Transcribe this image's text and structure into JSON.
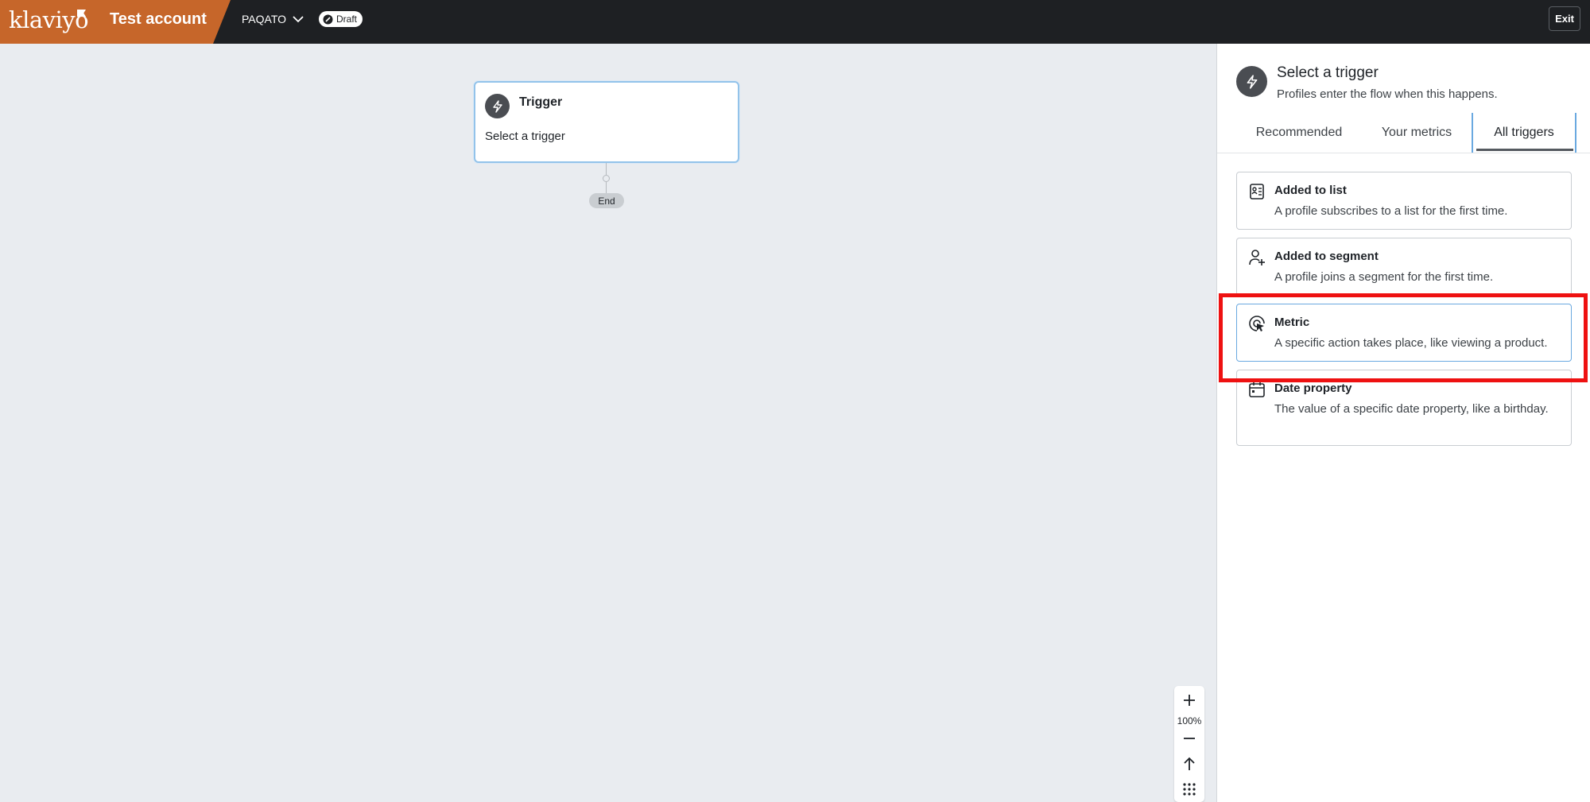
{
  "topbar": {
    "logo_text": "klaviyo",
    "account_name": "Test account",
    "flow_name": "PAQATO",
    "status_badge": "Draft",
    "exit_label": "Exit",
    "brand_color": "#c6662a"
  },
  "canvas": {
    "trigger_node": {
      "title": "Trigger",
      "subtitle": "Select a trigger"
    },
    "end_label": "End",
    "zoom_level": "100%"
  },
  "panel": {
    "title": "Select a trigger",
    "subtitle": "Profiles enter the flow when this happens.",
    "tabs": [
      {
        "label": "Recommended"
      },
      {
        "label": "Your metrics"
      },
      {
        "label": "All triggers",
        "active": true
      }
    ],
    "options": [
      {
        "icon": "list-icon",
        "title": "Added to list",
        "description": "A profile subscribes to a list for the first time."
      },
      {
        "icon": "user-plus-icon",
        "title": "Added to segment",
        "description": "A profile joins a segment for the first time."
      },
      {
        "icon": "cursor-click-icon",
        "title": "Metric",
        "description": "A specific action takes place, like viewing a product.",
        "selected": true
      },
      {
        "icon": "calendar-icon",
        "title": "Date property",
        "description": "The value of a specific date property, like a birthday."
      }
    ]
  },
  "colors": {
    "topbar_bg": "#1e2023",
    "canvas_bg": "#e9ecf0",
    "highlight": "#ee1111",
    "selected_border": "#6aa9e0"
  }
}
